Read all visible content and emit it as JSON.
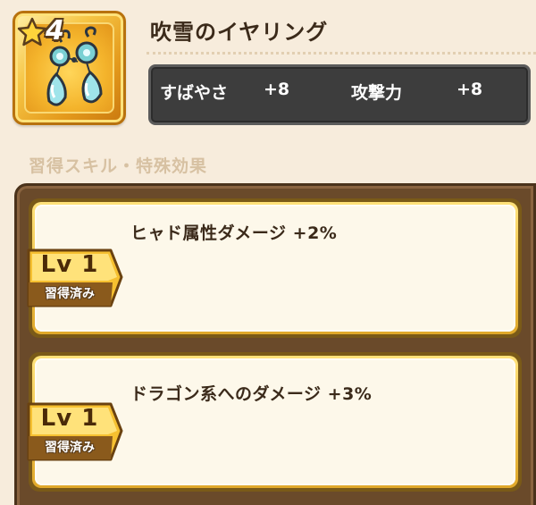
{
  "item": {
    "rarity": "4",
    "name": "吹雪のイヤリング",
    "icon": "earring-icon"
  },
  "stats": [
    {
      "label": "すばやさ",
      "value": "+8"
    },
    {
      "label": "攻撃力",
      "value": "+8"
    }
  ],
  "section_title": "習得スキル・特殊効果",
  "skills": [
    {
      "level": "Lv 1",
      "status": "習得済み",
      "description": "ヒャド属性ダメージ +2%"
    },
    {
      "level": "Lv 1",
      "status": "習得済み",
      "description": "ドラゴン系へのダメージ +3%"
    }
  ],
  "colors": {
    "background": "#f7ecdc",
    "frame_gold": "#e49a1c",
    "stats_box": "#3d3d3d",
    "panel_brown": "#6a4a2a"
  }
}
